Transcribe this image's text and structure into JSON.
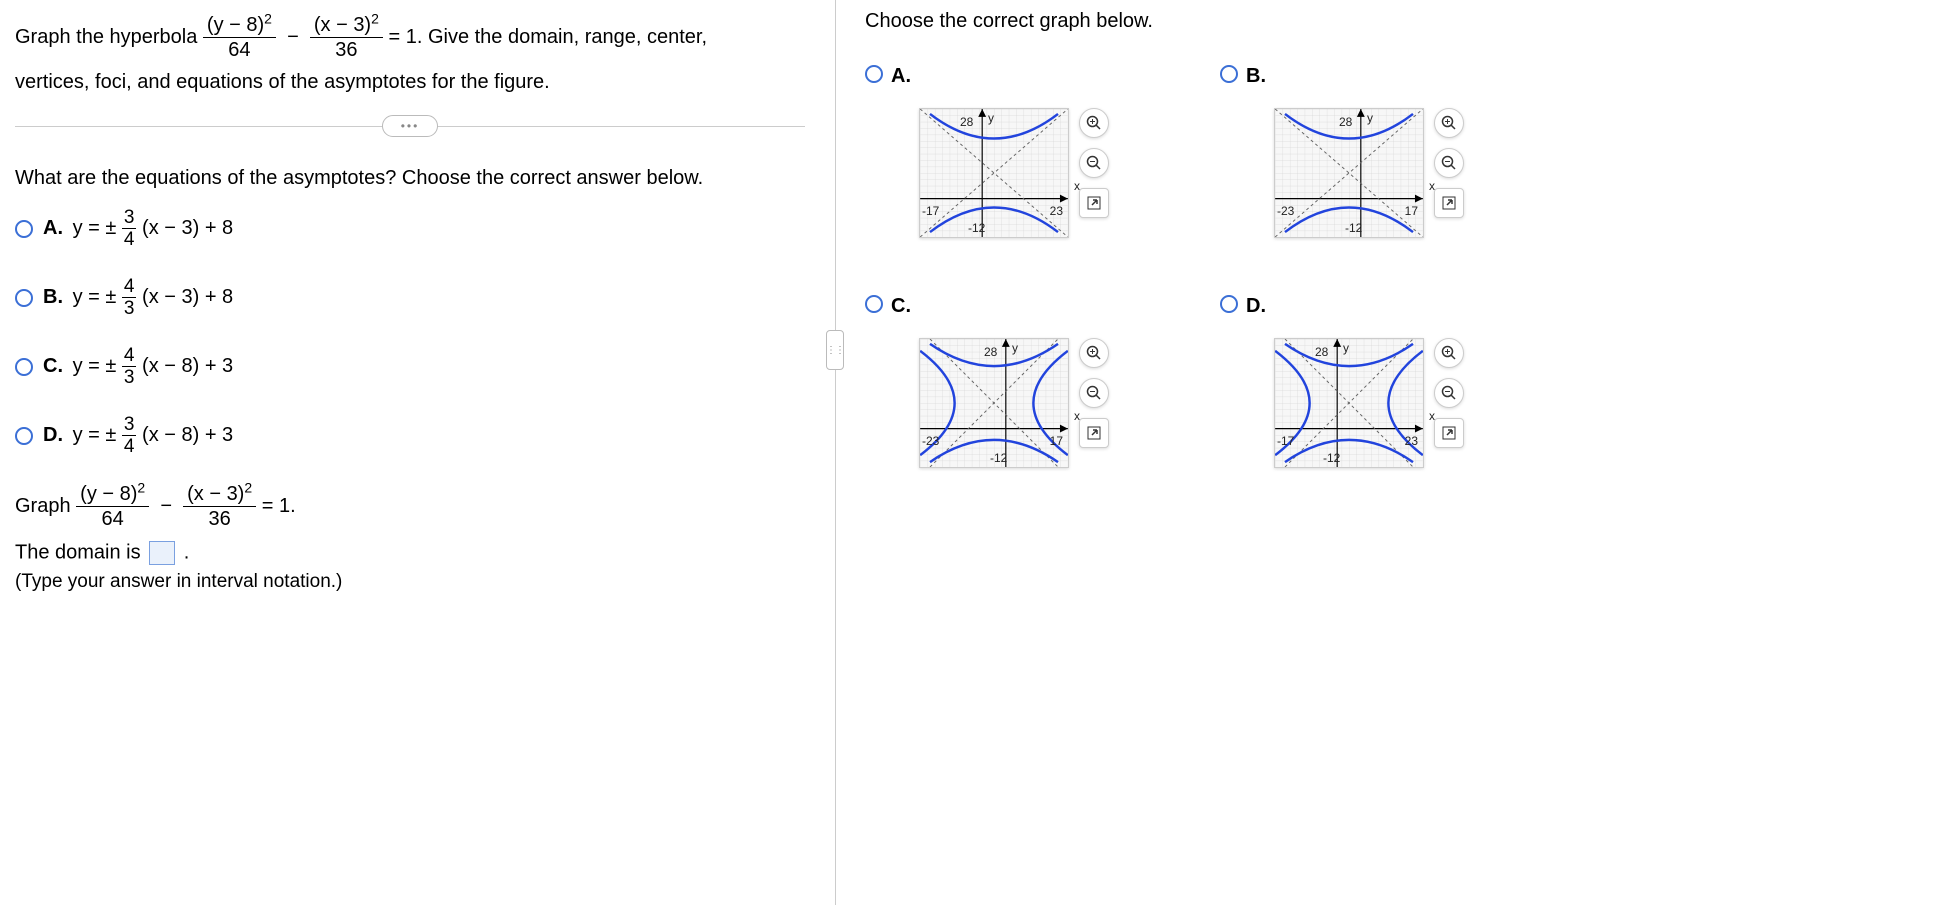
{
  "left": {
    "prompt_lead": "Graph the hyperbola ",
    "prompt_cont": " = 1. Give the domain, range, center,",
    "prompt_line2": "vertices, foci, and equations of the asymptotes for the figure.",
    "eq_num1": "(y − 8)",
    "eq_den1": "64",
    "eq_num2": "(x − 3)",
    "eq_den2": "36",
    "ellipsis": "•••",
    "question": "What are the equations of the asymptotes? Choose the correct answer below.",
    "options": [
      {
        "label": "A.",
        "pre": "y = ± ",
        "fnum": "3",
        "fden": "4",
        "post": "(x − 3) + 8"
      },
      {
        "label": "B.",
        "pre": "y = ± ",
        "fnum": "4",
        "fden": "3",
        "post": "(x − 3) + 8"
      },
      {
        "label": "C.",
        "pre": "y = ± ",
        "fnum": "4",
        "fden": "3",
        "post": "(x − 8) + 3"
      },
      {
        "label": "D.",
        "pre": "y = ± ",
        "fnum": "3",
        "fden": "4",
        "post": "(x − 8) + 3"
      }
    ],
    "graph_lead": "Graph ",
    "graph_cont": " = 1.",
    "domain_lead": "The domain is ",
    "domain_trail": ".",
    "hint": "(Type your answer in interval notation.)"
  },
  "right": {
    "prompt": "Choose the correct graph below.",
    "options": [
      {
        "label": "A.",
        "x_left": "-17",
        "x_right": "23",
        "y_top": "28",
        "y_bot": "-12"
      },
      {
        "label": "B.",
        "x_left": "-23",
        "x_right": "17",
        "y_top": "28",
        "y_bot": "-12"
      },
      {
        "label": "C.",
        "x_left": "-23",
        "x_right": "17",
        "y_top": "28",
        "y_bot": "-12"
      },
      {
        "label": "D.",
        "x_left": "-17",
        "x_right": "23",
        "y_top": "28",
        "y_bot": "-12"
      }
    ],
    "axis_x": "x",
    "axis_y": "y",
    "zoom_in": "+",
    "zoom_out": "−",
    "expand": "↗"
  }
}
